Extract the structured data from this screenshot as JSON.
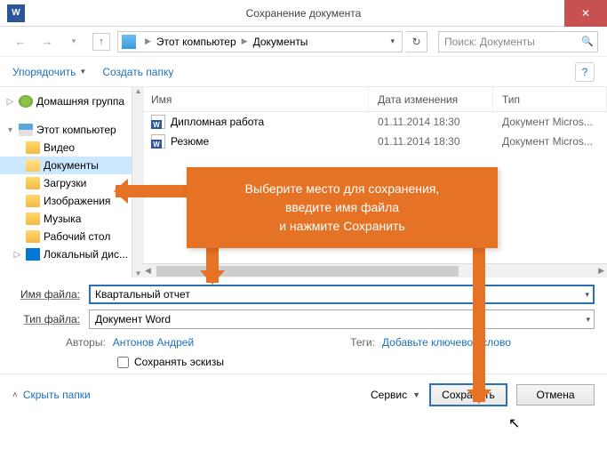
{
  "window": {
    "title": "Сохранение документа",
    "app_letter": "W",
    "close": "✕"
  },
  "nav": {
    "breadcrumb": {
      "root": "Этот компьютер",
      "folder": "Документы"
    },
    "search_placeholder": "Поиск: Документы"
  },
  "toolbar": {
    "organize": "Упорядочить",
    "new_folder": "Создать папку"
  },
  "sidebar": {
    "homegroup": "Домашняя группа",
    "pc": "Этот компьютер",
    "items": [
      {
        "label": "Видео"
      },
      {
        "label": "Документы",
        "selected": true
      },
      {
        "label": "Загрузки"
      },
      {
        "label": "Изображения"
      },
      {
        "label": "Музыка"
      },
      {
        "label": "Рабочий стол"
      },
      {
        "label": "Локальный дис..."
      }
    ]
  },
  "filelist": {
    "headers": {
      "name": "Имя",
      "date": "Дата изменения",
      "type": "Тип"
    },
    "rows": [
      {
        "name": "Дипломная работа",
        "date": "01.11.2014 18:30",
        "type": "Документ Micros..."
      },
      {
        "name": "Резюме",
        "date": "01.11.2014 18:30",
        "type": "Документ Micros..."
      }
    ]
  },
  "form": {
    "filename_label": "Имя файла:",
    "filename_value": "Квартальный отчет",
    "filetype_label": "Тип файла:",
    "filetype_value": "Документ Word",
    "authors_label": "Авторы:",
    "authors_value": "Антонов Андрей",
    "tags_label": "Теги:",
    "tags_value": "Добавьте ключевое слово",
    "thumbnails": "Сохранять эскизы"
  },
  "footer": {
    "hide": "Скрыть папки",
    "tools": "Сервис",
    "save": "Сохранить",
    "cancel": "Отмена"
  },
  "callout": {
    "line1": "Выберите место для сохранения,",
    "line2": "введите имя файла",
    "line3": "и нажмите Сохранить"
  }
}
